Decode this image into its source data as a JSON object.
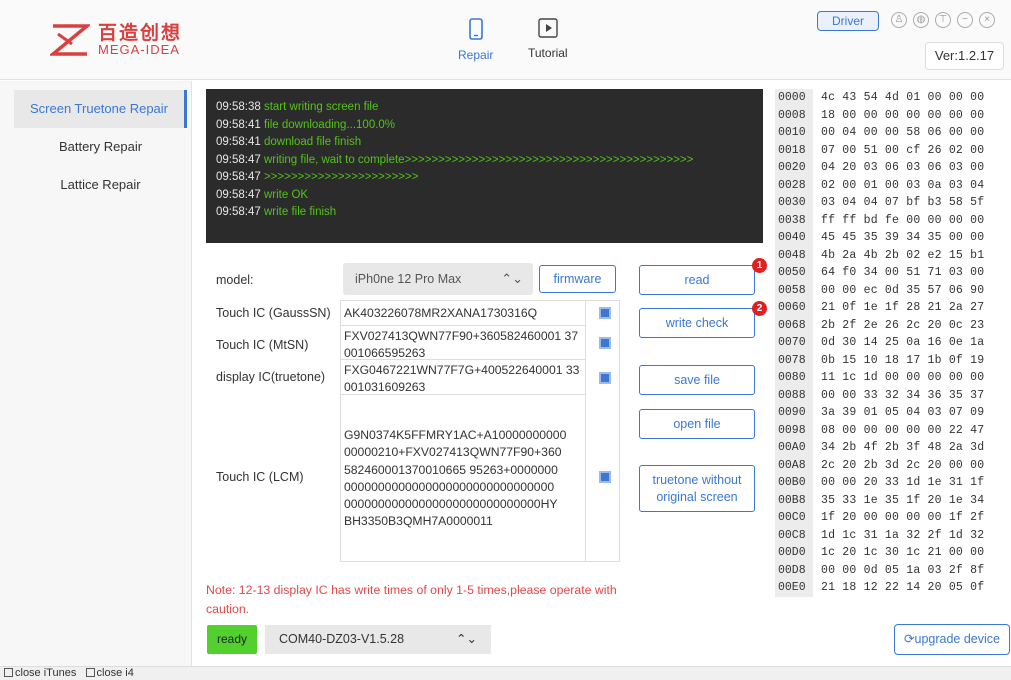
{
  "header": {
    "brand_cn": "百造创想",
    "brand_en": "MEGA-IDEA",
    "tabs": [
      {
        "label": "Repair",
        "icon": "phone-icon"
      },
      {
        "label": "Tutorial",
        "icon": "play-icon"
      }
    ],
    "driver_label": "Driver",
    "version": "Ver:1.2.17",
    "window_controls": [
      "user-icon",
      "globe-icon",
      "shirt-icon",
      "minimize-icon",
      "close-icon"
    ]
  },
  "sidebar": {
    "items": [
      {
        "label": "Screen Truetone Repair"
      },
      {
        "label": "Battery Repair"
      },
      {
        "label": "Lattice Repair"
      }
    ]
  },
  "console": {
    "lines": [
      {
        "time": "09:58:38",
        "text": "start writing screen file"
      },
      {
        "time": "09:58:41",
        "text": "file downloading...100.0%"
      },
      {
        "time": "09:58:41",
        "text": "download file finish"
      },
      {
        "time": "09:58:47",
        "text": "writing file, wait to complete>>>>>>>>>>>>>>>>>>>>>>>>>>>>>>>>>>>>>>>>>>>"
      },
      {
        "time": "09:58:47",
        "text": ">>>>>>>>>>>>>>>>>>>>>>>"
      },
      {
        "time": "09:58:47",
        "text": "write OK"
      },
      {
        "time": "09:58:47",
        "text": "write file finish"
      }
    ]
  },
  "form": {
    "model_label": "model:",
    "model_value": "iPh0ne 12 Pro Max",
    "firmware_label": "firmware",
    "rows": [
      {
        "label": "Touch IC (GaussSN)",
        "value": "AK403226078MR2XANA1730316Q"
      },
      {
        "label": "Touch IC (MtSN)",
        "value": "FXV027413QWN77F90+360582460001 37001066595263"
      },
      {
        "label": "display IC(truetone)",
        "value": "FXG0467221WN77F7G+400522640001 33001031609263"
      },
      {
        "label": "Touch IC (LCM)",
        "value": "G9N0374K5FFMRY1AC+A10000000000 00000210+FXV027413QWN77F90+360 582460001370010665 95263+0000000 0000000000000000000000000000000 00000000000000000000000000000HY BH3350B3QMH7A0000011"
      }
    ],
    "lcm_lines": [
      "G9N0374K5FFMRY1AC+A10000000000",
      "00000210+FXV027413QWN77F90+360",
      "582460001370010665 95263+0000000",
      "0000000000000000000000000000000",
      "00000000000000000000000000000HY",
      "BH3350B3QMH7A0000011"
    ]
  },
  "actions": {
    "read": "read",
    "write_check": "write check",
    "save_file": "save file",
    "open_file": "open file",
    "truetone_line1": "truetone without",
    "truetone_line2": "original screen",
    "badge1": "1",
    "badge2": "2"
  },
  "note": "Note: 12-13 display IC has write times of only 1-5 times,please operate with caution.",
  "status": {
    "ready": "ready",
    "port": "COM40-DZ03-V1.5.28",
    "upgrade": "upgrade device"
  },
  "footer": {
    "close_itunes": "close iTunes",
    "close_i4": "close i4"
  },
  "hex_dump": [
    {
      "addr": "0000",
      "bytes": "4c 43 54 4d 01 00 00 00"
    },
    {
      "addr": "0008",
      "bytes": "18 00 00 00 00 00 00 00"
    },
    {
      "addr": "0010",
      "bytes": "00 04 00 00 58 06 00 00"
    },
    {
      "addr": "0018",
      "bytes": "07 00 51 00 cf 26 02 00"
    },
    {
      "addr": "0020",
      "bytes": "04 20 03 06 03 06 03 00"
    },
    {
      "addr": "0028",
      "bytes": "02 00 01 00 03 0a 03 04"
    },
    {
      "addr": "0030",
      "bytes": "03 04 04 07 bf b3 58 5f"
    },
    {
      "addr": "0038",
      "bytes": "ff ff bd fe 00 00 00 00"
    },
    {
      "addr": "0040",
      "bytes": "45 45 35 39 34 35 00 00"
    },
    {
      "addr": "0048",
      "bytes": "4b 2a 4b 2b 02 e2 15 b1"
    },
    {
      "addr": "0050",
      "bytes": "64 f0 34 00 51 71 03 00"
    },
    {
      "addr": "0058",
      "bytes": "00 00 ec 0d 35 57 06 90"
    },
    {
      "addr": "0060",
      "bytes": "21 0f 1e 1f 28 21 2a 27"
    },
    {
      "addr": "0068",
      "bytes": "2b 2f 2e 26 2c 20 0c 23"
    },
    {
      "addr": "0070",
      "bytes": "0d 30 14 25 0a 16 0e 1a"
    },
    {
      "addr": "0078",
      "bytes": "0b 15 10 18 17 1b 0f 19"
    },
    {
      "addr": "0080",
      "bytes": "11 1c 1d 00 00 00 00 00"
    },
    {
      "addr": "0088",
      "bytes": "00 00 33 32 34 36 35 37"
    },
    {
      "addr": "0090",
      "bytes": "3a 39 01 05 04 03 07 09"
    },
    {
      "addr": "0098",
      "bytes": "08 00 00 00 00 00 22 47"
    },
    {
      "addr": "00A0",
      "bytes": "34 2b 4f 2b 3f 48 2a 3d"
    },
    {
      "addr": "00A8",
      "bytes": "2c 20 2b 3d 2c 20 00 00"
    },
    {
      "addr": "00B0",
      "bytes": "00 00 20 33 1d 1e 31 1f"
    },
    {
      "addr": "00B8",
      "bytes": "35 33 1e 35 1f 20 1e 34"
    },
    {
      "addr": "00C0",
      "bytes": "1f 20 00 00 00 00 1f 2f"
    },
    {
      "addr": "00C8",
      "bytes": "1d 1c 31 1a 32 2f 1d 32"
    },
    {
      "addr": "00D0",
      "bytes": "1c 20 1c 30 1c 21 00 00"
    },
    {
      "addr": "00D8",
      "bytes": "00 00 0d 05 1a 03 2f 8f"
    },
    {
      "addr": "00E0",
      "bytes": "21 18 12 22 14 20 05 0f"
    }
  ],
  "colors": {
    "accent": "#3a78d4",
    "brand": "#d94040",
    "console_bg": "#2b2b2b",
    "console_text": "#52c41a",
    "ready": "#52d12e",
    "warning": "#e04848"
  }
}
